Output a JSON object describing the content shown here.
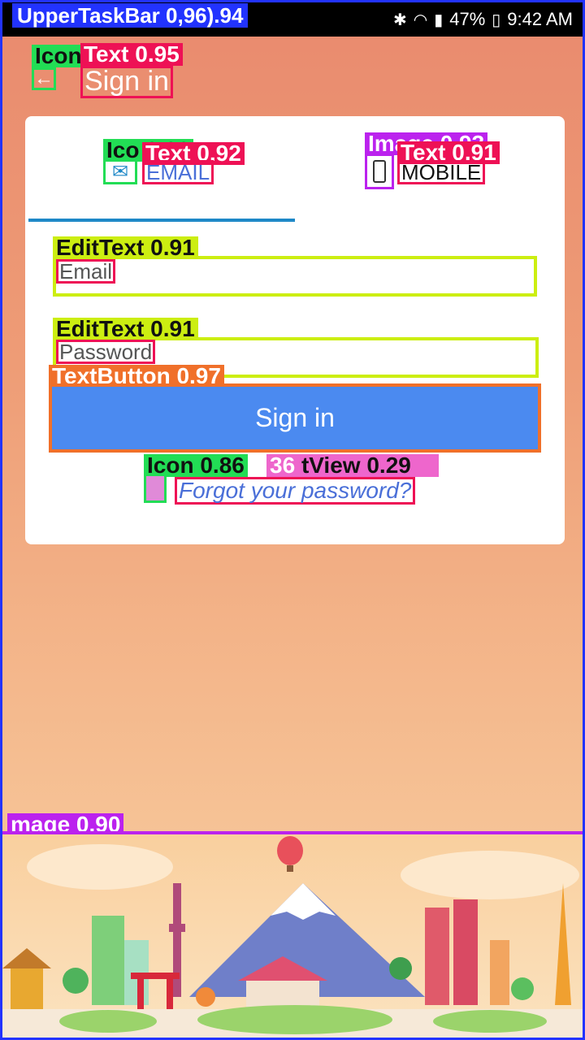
{
  "status_bar": {
    "annotation": "UpperTaskBar 0,96).94",
    "battery": "47%",
    "time": "9:42 AM"
  },
  "header": {
    "back_annotation": "Icon",
    "title_annotation": "Text 0.95",
    "title": "Sign in"
  },
  "tabs": {
    "email_icon_annotation": "Ico 0.90",
    "email_label_annotation": "Text 0.92",
    "email_label": "EMAIL",
    "mobile_icon_annotation": "Image 0.93",
    "mobile_label_annotation": "Text 0.91",
    "mobile_label": "MOBILE"
  },
  "form": {
    "email_annotation": "EditText 0.91",
    "email_placeholder": "Email",
    "password_annotation": "EditText 0.91",
    "password_placeholder": "Password",
    "signin_annotation": "TextButton 0.97",
    "signin_label": "Sign in",
    "forgot_icon_annotation": "Icon 0.86",
    "forgot_overlap_annotation": "36",
    "forgot_view_annotation": "tView 0.29",
    "forgot_label": "Forgot your password?"
  },
  "illustration": {
    "annotation": "mage 0.90"
  }
}
